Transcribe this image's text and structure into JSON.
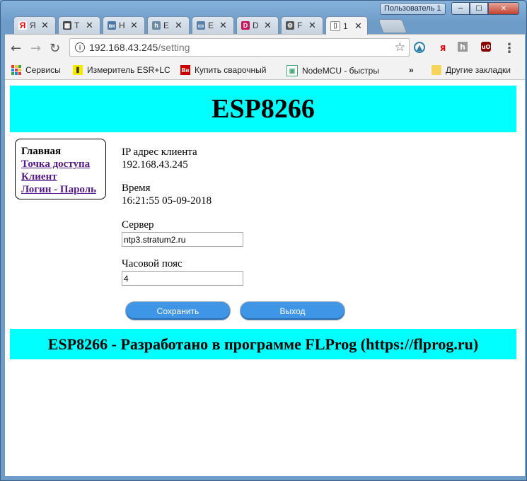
{
  "window": {
    "user_button": "Пользователь 1",
    "min_label": "─",
    "max_label": "☐",
    "close_label": "✕"
  },
  "tabs": [
    {
      "label": "Я",
      "icon": "yandex-icon",
      "color": "#ff0000",
      "glyph": "Я"
    },
    {
      "label": "Т",
      "icon": "tool-icon",
      "color": "#444444",
      "glyph": "▦"
    },
    {
      "label": "Н",
      "icon": "vk-icon",
      "color": "#4a76a8",
      "glyph": "вк"
    },
    {
      "label": "E",
      "icon": "h-icon",
      "color": "#6b8ba4",
      "glyph": "h"
    },
    {
      "label": "E",
      "icon": "monitor-icon",
      "color": "#5a7fa8",
      "glyph": "▭"
    },
    {
      "label": "D",
      "icon": "d-icon",
      "color": "#c2185b",
      "glyph": "D"
    },
    {
      "label": "F",
      "icon": "flprog-icon",
      "color": "#555555",
      "glyph": "⚙"
    },
    {
      "label": "1",
      "icon": "page-icon",
      "color": "#777777",
      "glyph": "▯"
    }
  ],
  "toolbar": {
    "back": "←",
    "forward": "→",
    "reload": "↻",
    "url_host": "192.168.43.245",
    "url_path": "/setting",
    "star": "☆",
    "menu": "⋮"
  },
  "bookmarks": [
    {
      "label": "Сервисы",
      "icon": "apps-icon"
    },
    {
      "label": "Измеритель ESR+LC",
      "icon": "esr-icon"
    },
    {
      "label": "Купить сварочный",
      "icon": "vi-icon"
    },
    {
      "label": "NodeMCU - быстры",
      "icon": "nodemcu-icon"
    }
  ],
  "bookmarks_more": "»",
  "bookmarks_other": "Другие закладки",
  "page": {
    "title": "ESP8266",
    "menu": {
      "home": "Главная",
      "access_point": "Точка доступа",
      "client": "Клиент",
      "login_password": "Логин - Пароль"
    },
    "ip_label": "IP адрес клиента",
    "ip_value": "192.168.43.245",
    "time_label": "Время",
    "time_value": "16:21:55 05-09-2018",
    "server_label": "Сервер",
    "server_value": "ntp3.stratum2.ru",
    "tz_label": "Часовой пояс",
    "tz_value": "4",
    "save_button": "Сохранить",
    "exit_button": "Выход",
    "footer": "ESP8266 - Разработано в программе FLProg (https://flprog.ru)"
  },
  "colors": {
    "header_bg": "#00ffff",
    "button_bg": "#3f95e6",
    "link": "#551a8b"
  }
}
